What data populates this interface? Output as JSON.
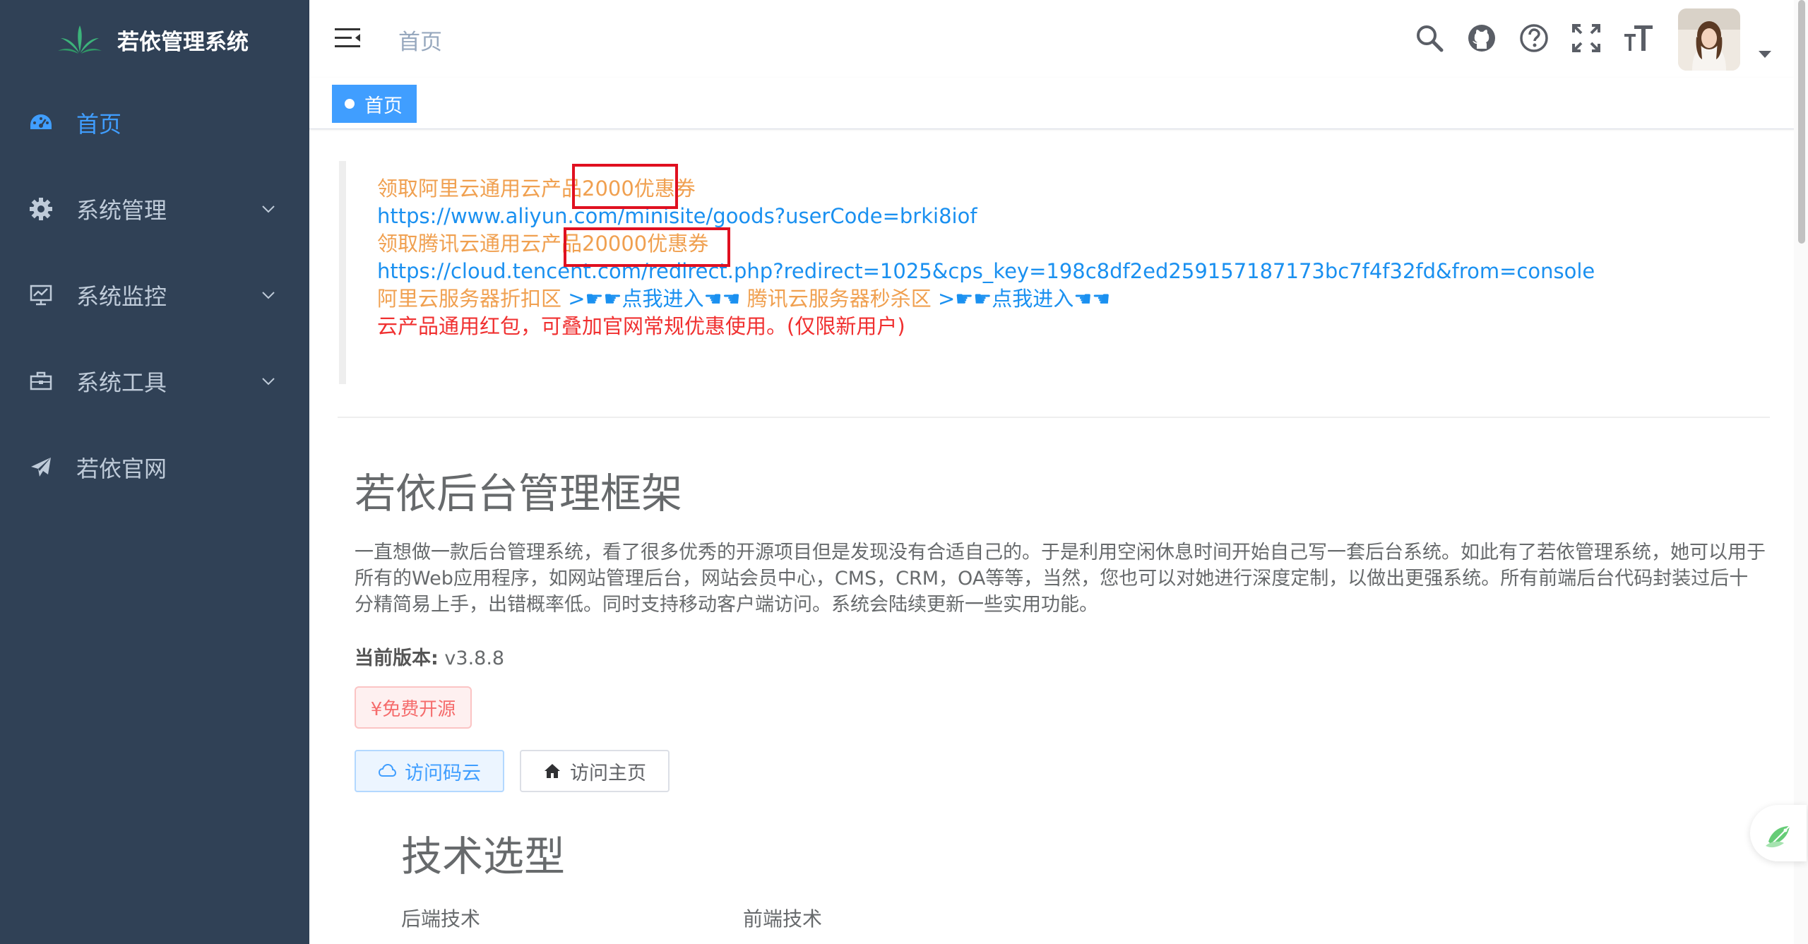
{
  "app": {
    "title": "若依管理系统"
  },
  "sidebar": {
    "items": [
      {
        "label": "首页",
        "icon": "dashboard-icon",
        "active": true
      },
      {
        "label": "系统管理",
        "icon": "gear-icon",
        "expandable": true
      },
      {
        "label": "系统监控",
        "icon": "monitor-icon",
        "expandable": true
      },
      {
        "label": "系统工具",
        "icon": "toolbox-icon",
        "expandable": true
      },
      {
        "label": "若依官网",
        "icon": "paper-plane-icon"
      }
    ]
  },
  "header": {
    "breadcrumb": "首页",
    "icons": [
      "search-icon",
      "github-icon",
      "help-icon",
      "fullscreen-icon",
      "font-size-icon"
    ]
  },
  "tags": {
    "active": "首页"
  },
  "notice": {
    "aliyun_text": "领取阿里云通用云产品2000优惠券",
    "aliyun_url": "https://www.aliyun.com/minisite/goods?userCode=brki8iof",
    "tencent_text": "领取腾讯云通用云产品20000优惠券",
    "tencent_url": "https://cloud.tencent.com/redirect.php?redirect=1025&cps_key=198c8df2ed259157187173bc7f4f32fd&from=console",
    "aliyun_discount": "阿里云服务器折扣区",
    "enter_link_1": ">☛☛点我进入☚☚",
    "tencent_seckill": "腾讯云服务器秒杀区",
    "enter_link_2": ">☛☛点我进入☚☚",
    "redpacket": "云产品通用红包，可叠加官网常规优惠使用。(仅限新用户)"
  },
  "main": {
    "title": "若依后台管理框架",
    "description": "一直想做一款后台管理系统，看了很多优秀的开源项目但是发现没有合适自己的。于是利用空闲休息时间开始自己写一套后台系统。如此有了若依管理系统，她可以用于所有的Web应用程序，如网站管理后台，网站会员中心，CMS，CRM，OA等等，当然，您也可以对她进行深度定制，以做出更强系统。所有前端后台代码封装过后十分精简易上手，出错概率低。同时支持移动客户端访问。系统会陆续更新一些实用功能。",
    "version_label": "当前版本:",
    "version_value": "v3.8.8",
    "free_tag": "¥免费开源",
    "btn_gitee": "访问码云",
    "btn_home": "访问主页",
    "tech_title": "技术选型",
    "backend_label": "后端技术",
    "frontend_label": "前端技术"
  },
  "colors": {
    "sidebar_bg": "#304156",
    "accent": "#409eff",
    "orange": "#f0a050",
    "red": "#f03030"
  }
}
